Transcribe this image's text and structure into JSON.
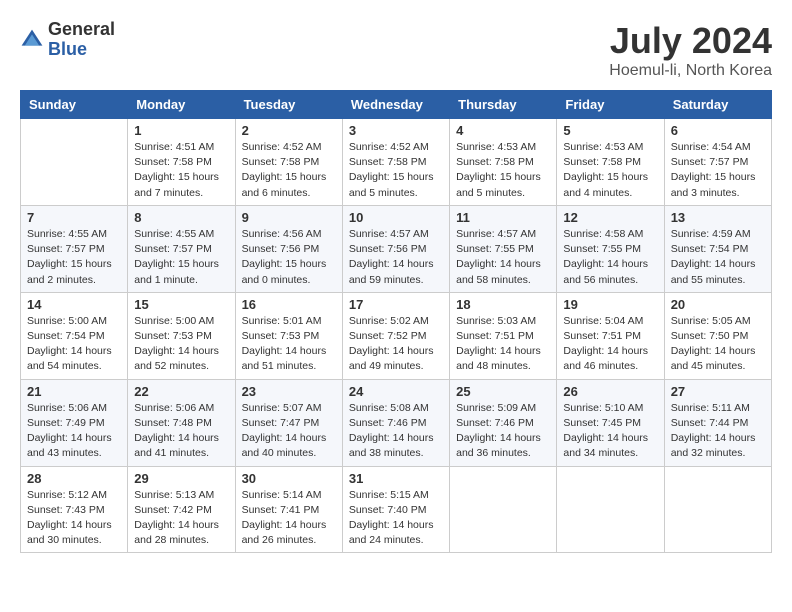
{
  "header": {
    "logo_general": "General",
    "logo_blue": "Blue",
    "month_title": "July 2024",
    "location": "Hoemul-li, North Korea"
  },
  "calendar": {
    "columns": [
      "Sunday",
      "Monday",
      "Tuesday",
      "Wednesday",
      "Thursday",
      "Friday",
      "Saturday"
    ],
    "weeks": [
      [
        {
          "day": "",
          "sunrise": "",
          "sunset": "",
          "daylight": ""
        },
        {
          "day": "1",
          "sunrise": "Sunrise: 4:51 AM",
          "sunset": "Sunset: 7:58 PM",
          "daylight": "Daylight: 15 hours and 7 minutes."
        },
        {
          "day": "2",
          "sunrise": "Sunrise: 4:52 AM",
          "sunset": "Sunset: 7:58 PM",
          "daylight": "Daylight: 15 hours and 6 minutes."
        },
        {
          "day": "3",
          "sunrise": "Sunrise: 4:52 AM",
          "sunset": "Sunset: 7:58 PM",
          "daylight": "Daylight: 15 hours and 5 minutes."
        },
        {
          "day": "4",
          "sunrise": "Sunrise: 4:53 AM",
          "sunset": "Sunset: 7:58 PM",
          "daylight": "Daylight: 15 hours and 5 minutes."
        },
        {
          "day": "5",
          "sunrise": "Sunrise: 4:53 AM",
          "sunset": "Sunset: 7:58 PM",
          "daylight": "Daylight: 15 hours and 4 minutes."
        },
        {
          "day": "6",
          "sunrise": "Sunrise: 4:54 AM",
          "sunset": "Sunset: 7:57 PM",
          "daylight": "Daylight: 15 hours and 3 minutes."
        }
      ],
      [
        {
          "day": "7",
          "sunrise": "Sunrise: 4:55 AM",
          "sunset": "Sunset: 7:57 PM",
          "daylight": "Daylight: 15 hours and 2 minutes."
        },
        {
          "day": "8",
          "sunrise": "Sunrise: 4:55 AM",
          "sunset": "Sunset: 7:57 PM",
          "daylight": "Daylight: 15 hours and 1 minute."
        },
        {
          "day": "9",
          "sunrise": "Sunrise: 4:56 AM",
          "sunset": "Sunset: 7:56 PM",
          "daylight": "Daylight: 15 hours and 0 minutes."
        },
        {
          "day": "10",
          "sunrise": "Sunrise: 4:57 AM",
          "sunset": "Sunset: 7:56 PM",
          "daylight": "Daylight: 14 hours and 59 minutes."
        },
        {
          "day": "11",
          "sunrise": "Sunrise: 4:57 AM",
          "sunset": "Sunset: 7:55 PM",
          "daylight": "Daylight: 14 hours and 58 minutes."
        },
        {
          "day": "12",
          "sunrise": "Sunrise: 4:58 AM",
          "sunset": "Sunset: 7:55 PM",
          "daylight": "Daylight: 14 hours and 56 minutes."
        },
        {
          "day": "13",
          "sunrise": "Sunrise: 4:59 AM",
          "sunset": "Sunset: 7:54 PM",
          "daylight": "Daylight: 14 hours and 55 minutes."
        }
      ],
      [
        {
          "day": "14",
          "sunrise": "Sunrise: 5:00 AM",
          "sunset": "Sunset: 7:54 PM",
          "daylight": "Daylight: 14 hours and 54 minutes."
        },
        {
          "day": "15",
          "sunrise": "Sunrise: 5:00 AM",
          "sunset": "Sunset: 7:53 PM",
          "daylight": "Daylight: 14 hours and 52 minutes."
        },
        {
          "day": "16",
          "sunrise": "Sunrise: 5:01 AM",
          "sunset": "Sunset: 7:53 PM",
          "daylight": "Daylight: 14 hours and 51 minutes."
        },
        {
          "day": "17",
          "sunrise": "Sunrise: 5:02 AM",
          "sunset": "Sunset: 7:52 PM",
          "daylight": "Daylight: 14 hours and 49 minutes."
        },
        {
          "day": "18",
          "sunrise": "Sunrise: 5:03 AM",
          "sunset": "Sunset: 7:51 PM",
          "daylight": "Daylight: 14 hours and 48 minutes."
        },
        {
          "day": "19",
          "sunrise": "Sunrise: 5:04 AM",
          "sunset": "Sunset: 7:51 PM",
          "daylight": "Daylight: 14 hours and 46 minutes."
        },
        {
          "day": "20",
          "sunrise": "Sunrise: 5:05 AM",
          "sunset": "Sunset: 7:50 PM",
          "daylight": "Daylight: 14 hours and 45 minutes."
        }
      ],
      [
        {
          "day": "21",
          "sunrise": "Sunrise: 5:06 AM",
          "sunset": "Sunset: 7:49 PM",
          "daylight": "Daylight: 14 hours and 43 minutes."
        },
        {
          "day": "22",
          "sunrise": "Sunrise: 5:06 AM",
          "sunset": "Sunset: 7:48 PM",
          "daylight": "Daylight: 14 hours and 41 minutes."
        },
        {
          "day": "23",
          "sunrise": "Sunrise: 5:07 AM",
          "sunset": "Sunset: 7:47 PM",
          "daylight": "Daylight: 14 hours and 40 minutes."
        },
        {
          "day": "24",
          "sunrise": "Sunrise: 5:08 AM",
          "sunset": "Sunset: 7:46 PM",
          "daylight": "Daylight: 14 hours and 38 minutes."
        },
        {
          "day": "25",
          "sunrise": "Sunrise: 5:09 AM",
          "sunset": "Sunset: 7:46 PM",
          "daylight": "Daylight: 14 hours and 36 minutes."
        },
        {
          "day": "26",
          "sunrise": "Sunrise: 5:10 AM",
          "sunset": "Sunset: 7:45 PM",
          "daylight": "Daylight: 14 hours and 34 minutes."
        },
        {
          "day": "27",
          "sunrise": "Sunrise: 5:11 AM",
          "sunset": "Sunset: 7:44 PM",
          "daylight": "Daylight: 14 hours and 32 minutes."
        }
      ],
      [
        {
          "day": "28",
          "sunrise": "Sunrise: 5:12 AM",
          "sunset": "Sunset: 7:43 PM",
          "daylight": "Daylight: 14 hours and 30 minutes."
        },
        {
          "day": "29",
          "sunrise": "Sunrise: 5:13 AM",
          "sunset": "Sunset: 7:42 PM",
          "daylight": "Daylight: 14 hours and 28 minutes."
        },
        {
          "day": "30",
          "sunrise": "Sunrise: 5:14 AM",
          "sunset": "Sunset: 7:41 PM",
          "daylight": "Daylight: 14 hours and 26 minutes."
        },
        {
          "day": "31",
          "sunrise": "Sunrise: 5:15 AM",
          "sunset": "Sunset: 7:40 PM",
          "daylight": "Daylight: 14 hours and 24 minutes."
        },
        {
          "day": "",
          "sunrise": "",
          "sunset": "",
          "daylight": ""
        },
        {
          "day": "",
          "sunrise": "",
          "sunset": "",
          "daylight": ""
        },
        {
          "day": "",
          "sunrise": "",
          "sunset": "",
          "daylight": ""
        }
      ]
    ]
  }
}
